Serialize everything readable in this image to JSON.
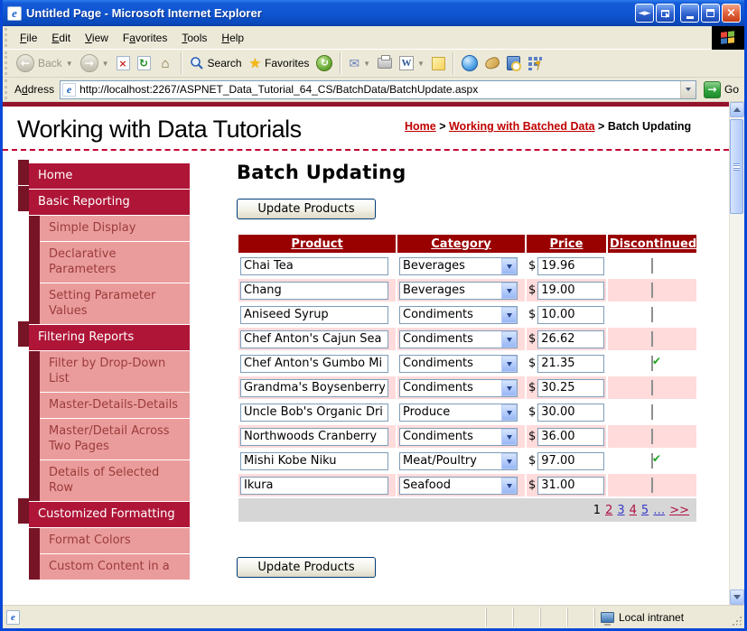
{
  "colors": {
    "grid_header_red": "#990000",
    "row_pink": "#FFDBDB",
    "sidebar_header_crimson": "#AF1537",
    "sidebar_shadow_maroon": "#771425",
    "sidebar_item_pink": "#EA9C9C",
    "sidebar_item_text": "#9C3B3B",
    "pager_bg": "#D6D6D6",
    "pager_link_red": "#B01141",
    "pager_link_blue": "#3A3ACA",
    "breadcrumb_link_red": "#C00000",
    "top_rule_maroon": "#95122B"
  },
  "window": {
    "title": "Untitled Page - Microsoft Internet Explorer"
  },
  "menu": {
    "items": [
      {
        "label": "File",
        "u": 0
      },
      {
        "label": "Edit",
        "u": 0
      },
      {
        "label": "View",
        "u": 0
      },
      {
        "label": "Favorites",
        "u": 1
      },
      {
        "label": "Tools",
        "u": 0
      },
      {
        "label": "Help",
        "u": 0
      }
    ]
  },
  "toolbar": {
    "back": "Back",
    "search": "Search",
    "favorites": "Favorites"
  },
  "address": {
    "label": "Address",
    "u": 1,
    "url": "http://localhost:2267/ASPNET_Data_Tutorial_64_CS/BatchData/BatchUpdate.aspx",
    "go": "Go"
  },
  "page": {
    "site_title": "Working with Data Tutorials",
    "breadcrumb_separator": " > ",
    "breadcrumb": [
      {
        "label": "Home",
        "link": true
      },
      {
        "label": "Working with Batched Data",
        "link": true
      },
      {
        "label": "Batch Updating",
        "link": false
      }
    ],
    "sidebar": {
      "sections": [
        {
          "title": "Home",
          "items": []
        },
        {
          "title": "Basic Reporting",
          "items": [
            "Simple Display",
            "Declarative Parameters",
            "Setting Parameter Values"
          ]
        },
        {
          "title": "Filtering Reports",
          "items": [
            "Filter by Drop-Down List",
            "Master-Details-Details",
            "Master/Detail Across Two Pages",
            "Details of Selected Row"
          ]
        },
        {
          "title": "Customized Formatting",
          "items": [
            "Format Colors",
            "Custom Content in a"
          ]
        }
      ]
    },
    "main": {
      "heading": "Batch Updating",
      "update_button": "Update Products",
      "table": {
        "columns": [
          "Product",
          "Category",
          "Price",
          "Discontinued"
        ],
        "currency": "$",
        "rows": [
          {
            "product": "Chai Tea",
            "category": "Beverages",
            "price": "19.96",
            "discontinued": false
          },
          {
            "product": "Chang",
            "category": "Beverages",
            "price": "19.00",
            "discontinued": false
          },
          {
            "product": "Aniseed Syrup",
            "category": "Condiments",
            "price": "10.00",
            "discontinued": false
          },
          {
            "product": "Chef Anton's Cajun Sea",
            "category": "Condiments",
            "price": "26.62",
            "discontinued": false
          },
          {
            "product": "Chef Anton's Gumbo Mi",
            "category": "Condiments",
            "price": "21.35",
            "discontinued": true
          },
          {
            "product": "Grandma's Boysenberry",
            "category": "Condiments",
            "price": "30.25",
            "discontinued": false
          },
          {
            "product": "Uncle Bob's Organic Dri",
            "category": "Produce",
            "price": "30.00",
            "discontinued": false
          },
          {
            "product": "Northwoods Cranberry",
            "category": "Condiments",
            "price": "36.00",
            "discontinued": false
          },
          {
            "product": "Mishi Kobe Niku",
            "category": "Meat/Poultry",
            "price": "97.00",
            "discontinued": true
          },
          {
            "product": "Ikura",
            "category": "Seafood",
            "price": "31.00",
            "discontinued": false
          }
        ],
        "pager": [
          {
            "label": "1",
            "type": "current"
          },
          {
            "label": "2",
            "type": "visited"
          },
          {
            "label": "3",
            "type": "link"
          },
          {
            "label": "4",
            "type": "visited"
          },
          {
            "label": "5",
            "type": "link"
          },
          {
            "label": "…",
            "type": "link"
          },
          {
            "label": ">>",
            "type": "visited"
          }
        ]
      }
    }
  },
  "status": {
    "zone": "Local intranet"
  }
}
